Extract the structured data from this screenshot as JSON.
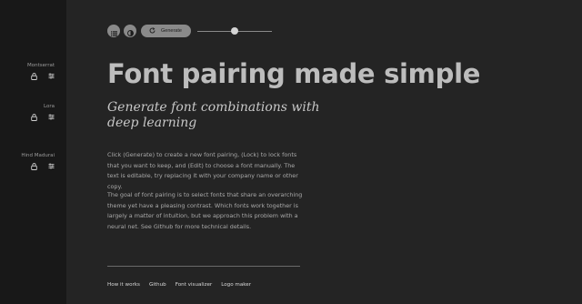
{
  "sidebar": {
    "fonts": [
      {
        "name": "Montserrat"
      },
      {
        "name": "Lora"
      },
      {
        "name": "Hind Madurai"
      }
    ]
  },
  "toolbar": {
    "generate_label": "Generate",
    "slider_value": 0.5
  },
  "main": {
    "title": "Font pairing made simple",
    "subtitle": "Generate font combinations with deep learning",
    "paragraph1": "Click (Generate) to create a new font pairing, (Lock) to lock fonts that you want to keep, and (Edit) to choose a font manually. The text is editable, try replacing it with your company name or other copy.",
    "paragraph2": "The goal of font pairing is to select fonts that share an overarching theme yet have a pleasing contrast. Which fonts work together is largely a matter of intuition, but we approach this problem with a neural net. See Github for more technical details."
  },
  "footer": {
    "links": [
      "How it works",
      "Github",
      "Font visualizer",
      "Logo maker"
    ]
  },
  "colors": {
    "sidebar_bg": "#181818",
    "main_bg": "#242424",
    "button_bg": "#8a8a8a"
  }
}
